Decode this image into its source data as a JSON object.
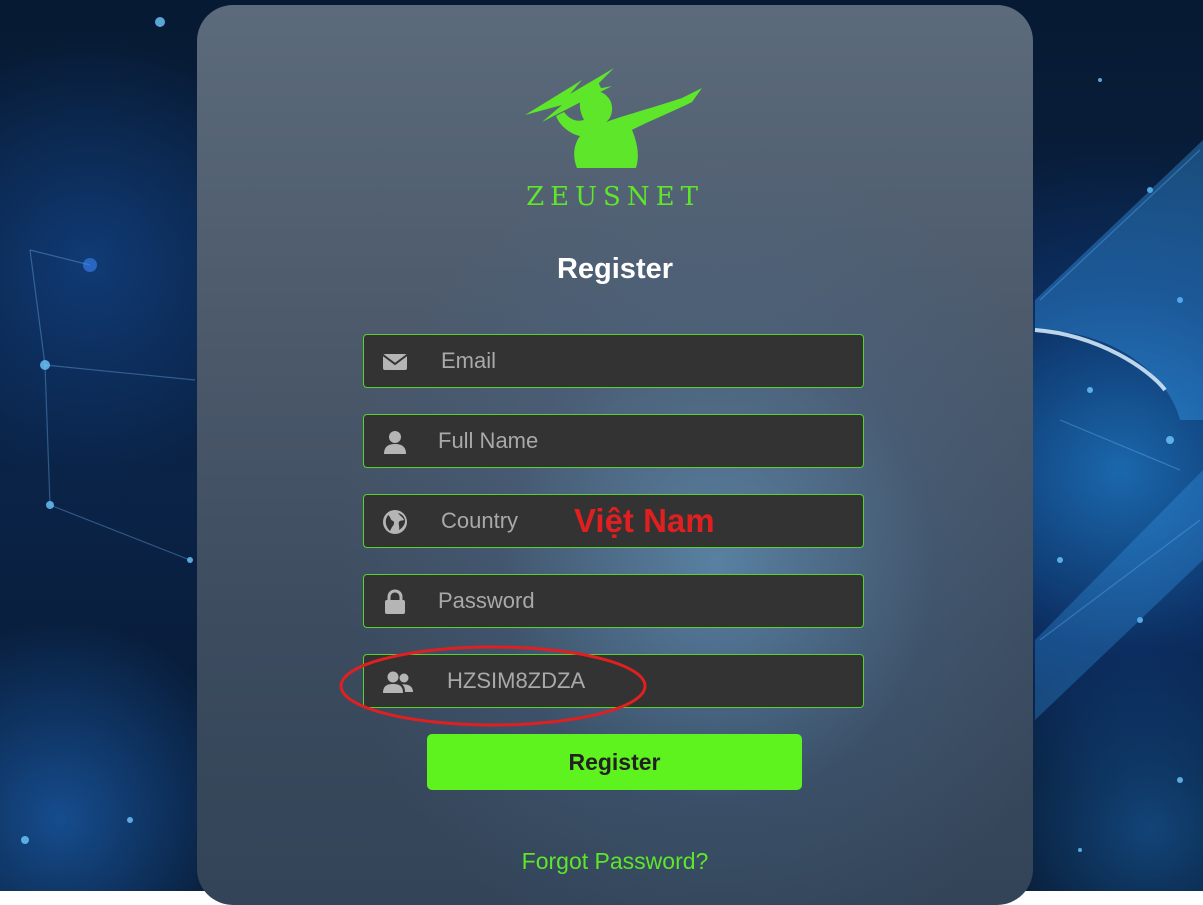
{
  "brand": {
    "name": "ZEUSNET",
    "color": "#5ee62a"
  },
  "page": {
    "title": "Register"
  },
  "fields": [
    {
      "id": "email",
      "icon": "envelope-icon",
      "placeholder": "Email",
      "value": ""
    },
    {
      "id": "full_name",
      "icon": "user-icon",
      "placeholder": "Full Name",
      "value": ""
    },
    {
      "id": "country",
      "icon": "globe-icon",
      "placeholder": "Country",
      "value": ""
    },
    {
      "id": "password",
      "icon": "lock-icon",
      "placeholder": "Password",
      "value": ""
    },
    {
      "id": "referral",
      "icon": "users-icon",
      "placeholder": "",
      "value": "HZSIM8ZDZA"
    }
  ],
  "annotations": {
    "country_note": "Việt Nam",
    "note_color": "#e02020",
    "highlight": "red-ellipse"
  },
  "actions": {
    "register_label": "Register",
    "forgot_label": "Forgot Password?",
    "button_color": "#5ef21f"
  }
}
